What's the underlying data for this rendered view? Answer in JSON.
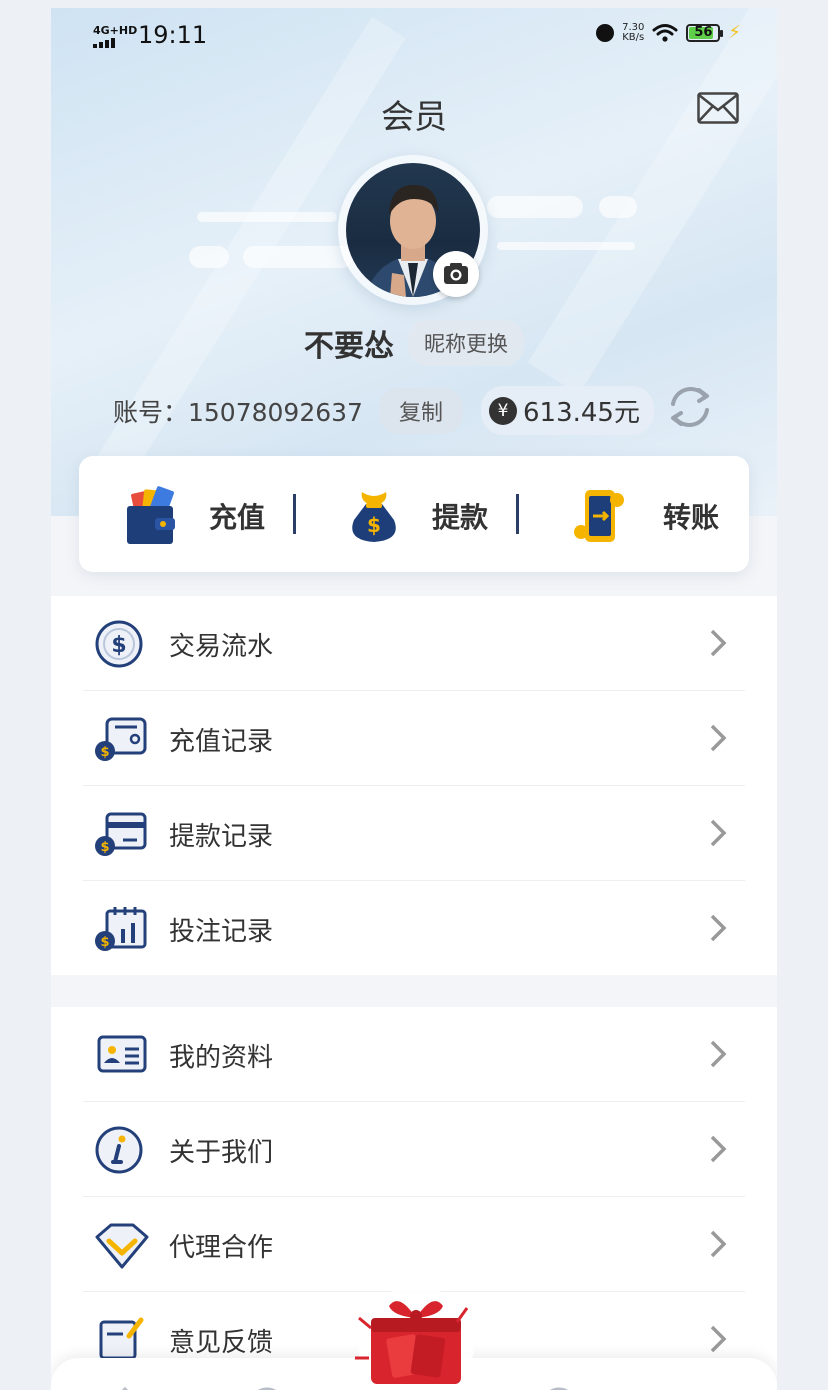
{
  "status_bar": {
    "network": "4G+HD",
    "time": "19:11",
    "net_speed_value": "7.30",
    "net_speed_unit": "KB/s",
    "battery": "56"
  },
  "header": {
    "title": "会员",
    "nickname": "不要怂",
    "change_nickname_label": "昵称更换",
    "account_text": "账号：15078092637",
    "copy_label": "复制",
    "currency_symbol": "¥",
    "balance": "613.45元"
  },
  "quick_actions": [
    {
      "label": "充值",
      "icon": "wallet-icon"
    },
    {
      "label": "提款",
      "icon": "money-bag-icon"
    },
    {
      "label": "转账",
      "icon": "transfer-phone-icon"
    }
  ],
  "records_list": [
    {
      "label": "交易流水",
      "icon": "dollar-coin-icon"
    },
    {
      "label": "充值记录",
      "icon": "wallet-dollar-icon"
    },
    {
      "label": "提款记录",
      "icon": "card-dollar-icon"
    },
    {
      "label": "投注记录",
      "icon": "calendar-chart-icon"
    }
  ],
  "more_list": [
    {
      "label": "我的资料",
      "icon": "id-card-icon"
    },
    {
      "label": "关于我们",
      "icon": "info-icon"
    },
    {
      "label": "代理合作",
      "icon": "diamond-icon"
    },
    {
      "label": "意见反馈",
      "icon": "feedback-icon"
    }
  ],
  "colors": {
    "header_bg": "#dbeaf5",
    "accent_navy": "#2b3f66",
    "accent_gold": "#f3c31a",
    "gift_red": "#d8242c"
  }
}
